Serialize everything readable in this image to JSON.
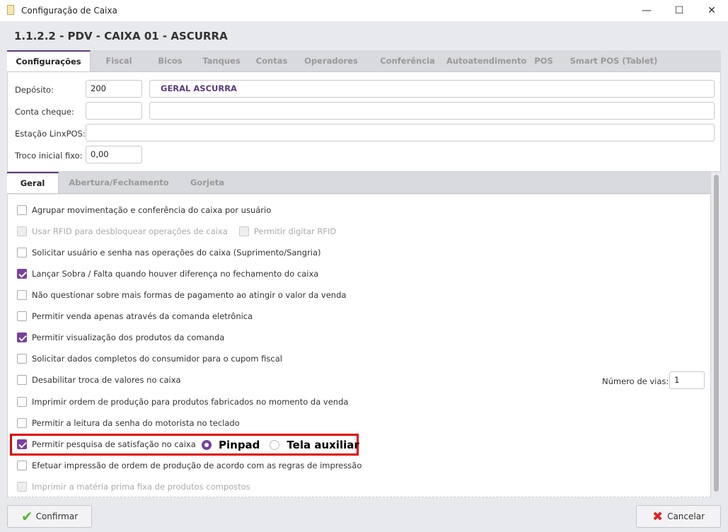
{
  "window": {
    "title": "Configuração de Caixa",
    "minimize": "—",
    "maximize": "☐",
    "close": "✕"
  },
  "header": {
    "title": "1.1.2.2 - PDV - CAIXA 01 - ASCURRA"
  },
  "tabs": [
    {
      "label": "Configurações",
      "active": true
    },
    {
      "label": "Fiscal"
    },
    {
      "label": "Bicos"
    },
    {
      "label": "Tanques"
    },
    {
      "label": "Contas"
    },
    {
      "label": "Operadores"
    },
    {
      "label": "Conferência"
    },
    {
      "label": "Autoatendimento"
    },
    {
      "label": "POS"
    },
    {
      "label": "Smart POS (Tablet)"
    }
  ],
  "form": {
    "deposito_label": "Depósito:",
    "deposito_code": "200",
    "deposito_name": "GERAL ASCURRA",
    "conta_label": "Conta cheque:",
    "conta_code": "",
    "conta_name": "",
    "estacao_label": "Estação LinxPOS:",
    "estacao_value": "",
    "troco_label": "Troco inicial fixo:",
    "troco_value": "0,00"
  },
  "subtabs": [
    {
      "label": "Geral",
      "active": true
    },
    {
      "label": "Abertura/Fechamento"
    },
    {
      "label": "Gorjeta"
    }
  ],
  "options": [
    {
      "label": "Agrupar movimentação e conferência do caixa por usuário",
      "checked": false
    },
    {
      "label": "Usar RFID para desbloquear operações de caixa",
      "checked": false,
      "disabled": true,
      "extra": "Permitir digitar RFID"
    },
    {
      "label": "Solicitar usuário e senha nas operações do caixa (Suprimento/Sangria)",
      "checked": false
    },
    {
      "label": "Lançar Sobra / Falta quando houver diferença no fechamento do caixa",
      "checked": true
    },
    {
      "label": "Não questionar sobre mais formas de pagamento ao atingir o valor da venda",
      "checked": false
    },
    {
      "label": "Permitir venda apenas através da comanda eletrônica",
      "checked": false
    },
    {
      "label": "Permitir visualização dos produtos da comanda",
      "checked": true
    },
    {
      "label": "Solicitar dados completos do consumidor para o cupom fiscal",
      "checked": false
    },
    {
      "label": "Desabilitar troca de valores no caixa",
      "checked": false
    },
    {
      "label": "Imprimir ordem de produção para produtos fabricados no momento da venda",
      "checked": false
    },
    {
      "label": "Permitir a leitura da senha do motorista no teclado",
      "checked": false
    },
    {
      "label": "Permitir pesquisa de satisfação no caixa",
      "checked": true
    },
    {
      "label": "Efetuar impressão de ordem de produção de acordo com as regras de impressão",
      "checked": false
    },
    {
      "label": "Imprimir a matéria prima fixa de produtos compostos",
      "checked": false,
      "disabled": true
    }
  ],
  "vias": {
    "label": "Número de vias:",
    "value": "1"
  },
  "survey": {
    "pinpad": "Pinpad",
    "tela": "Tela auxiliar",
    "selected": "Pinpad",
    "highlight_color": "#e00000"
  },
  "buttons": {
    "confirm": "Confirmar",
    "cancel": "Cancelar"
  },
  "colors": {
    "accent": "#7b3fa0"
  }
}
